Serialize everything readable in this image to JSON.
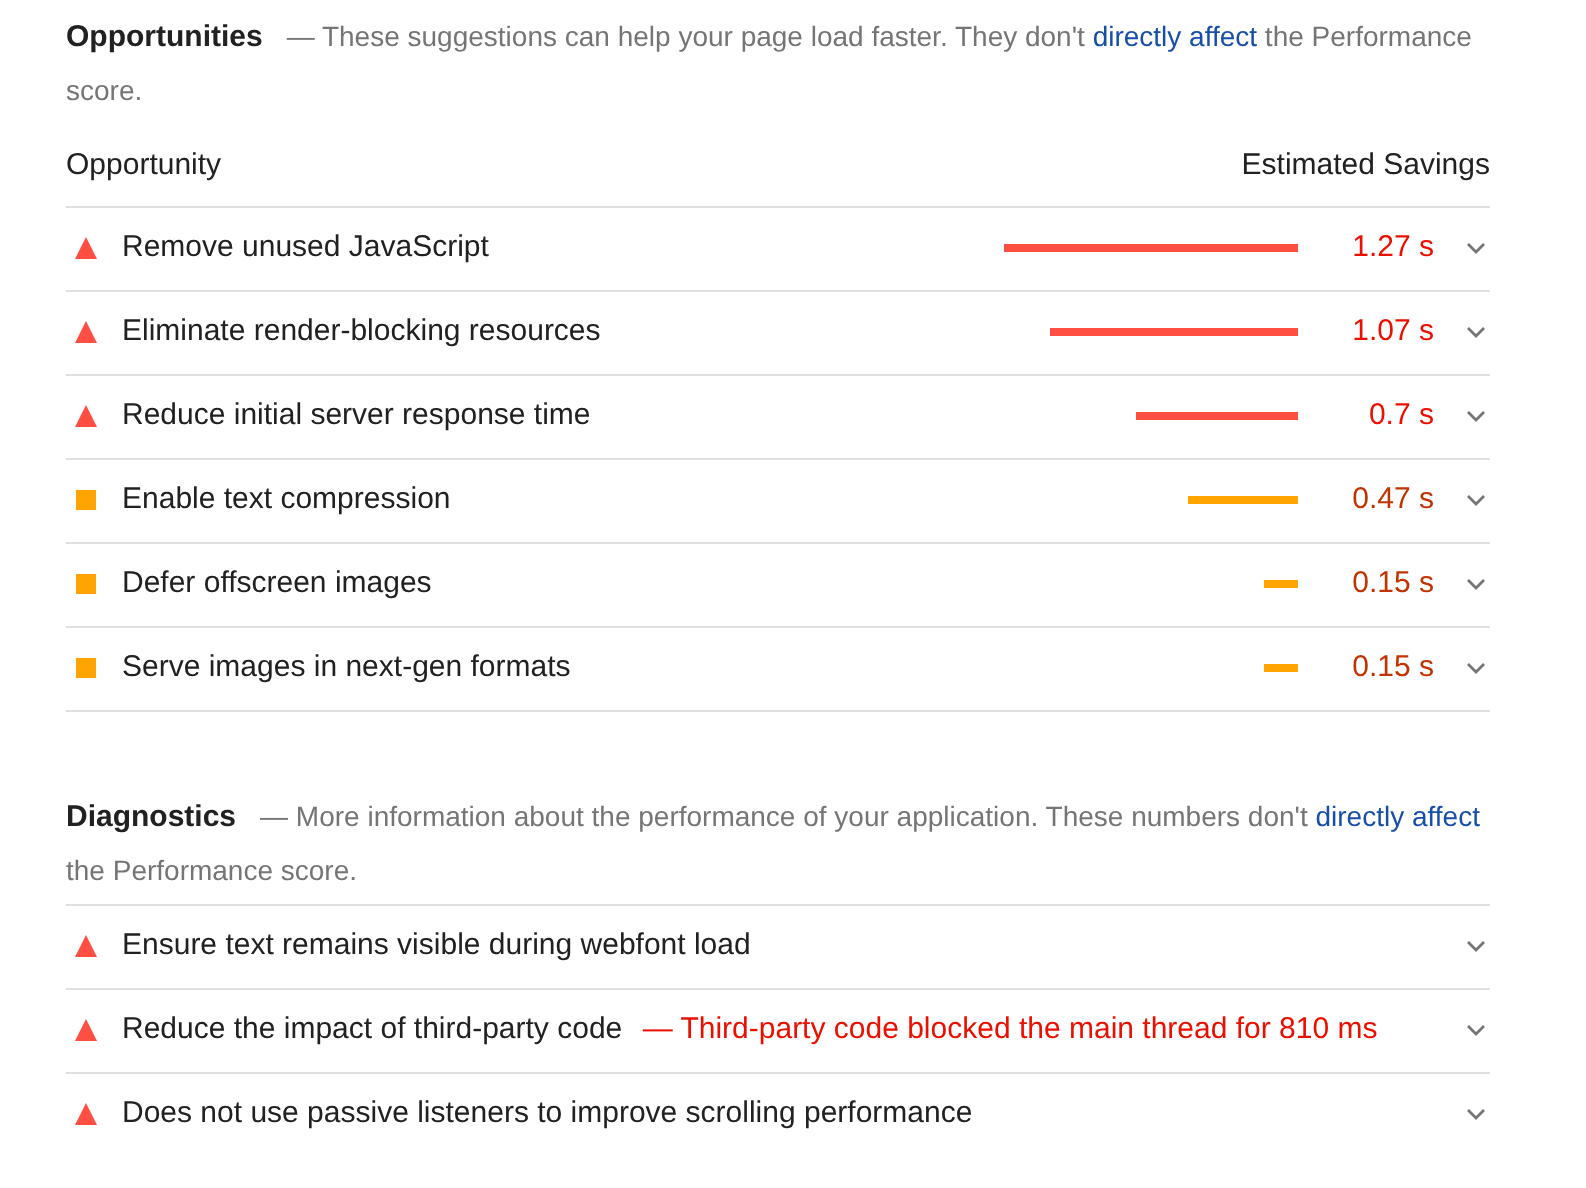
{
  "opportunities": {
    "title": "Opportunities",
    "description": {
      "before": "— These suggestions can help your page load faster. They don't",
      "link": "directly affect",
      "after": "the Performance score."
    },
    "columns": [
      "Opportunity",
      "Estimated Savings"
    ],
    "rows": [
      {
        "kind": "fail",
        "title": "Remove unused JavaScript",
        "savings": "1.27 s"
      },
      {
        "kind": "fail",
        "title": "Eliminate render-blocking resources",
        "savings": "1.07 s"
      },
      {
        "kind": "fail",
        "title": "Reduce initial server response time",
        "savings": "0.7 s"
      },
      {
        "kind": "average",
        "title": "Enable text compression",
        "savings": "0.47 s"
      },
      {
        "kind": "average",
        "title": "Defer offscreen images",
        "savings": "0.15 s"
      },
      {
        "kind": "average",
        "title": "Serve images in next-gen formats",
        "savings": "0.15 s"
      }
    ]
  },
  "diagnostics": {
    "title": "Diagnostics",
    "description": {
      "before": "— More information about the performance of your application. These numbers don't",
      "link": "directly affect",
      "after": "the Performance score."
    },
    "rows": [
      {
        "kind": "fail",
        "title": "Ensure text remains visible during webfont load"
      },
      {
        "kind": "fail",
        "title": "Reduce the impact of third-party code",
        "detail": "— Third-party code blocked the main thread for 810 ms"
      },
      {
        "kind": "fail",
        "title": "Does not use passive listeners to improve scrolling performance"
      }
    ]
  }
}
